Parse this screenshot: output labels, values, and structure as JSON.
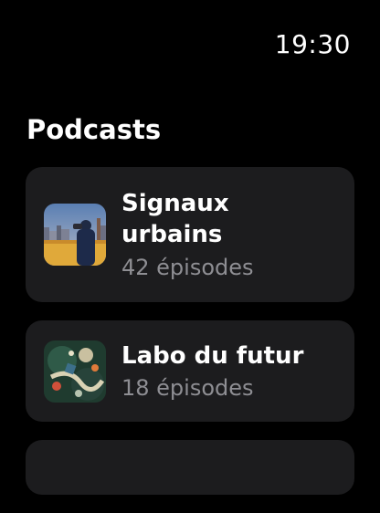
{
  "status": {
    "time": "19:30"
  },
  "header": {
    "title": "Podcasts"
  },
  "podcasts": [
    {
      "title": "Signaux urbains",
      "episodes": "42 épisodes",
      "artwork_icon": "city-skyline-artwork"
    },
    {
      "title": "Labo du futur",
      "episodes": "18 épisodes",
      "artwork_icon": "abstract-collage-artwork"
    }
  ],
  "colors": {
    "background": "#000000",
    "card": "#1c1c1e",
    "secondary_text": "#8e8e93"
  }
}
